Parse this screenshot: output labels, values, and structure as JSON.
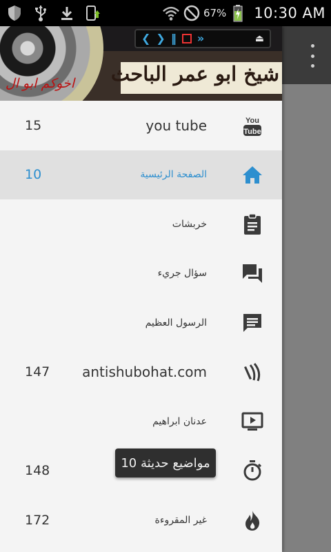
{
  "status_bar": {
    "battery_percent": "67%",
    "time": "10:30 AM",
    "icons": [
      "shield-icon",
      "usb-icon",
      "download-icon",
      "phone-signal-icon",
      "wifi-icon",
      "do-not-disturb-icon",
      "battery-charging-icon"
    ]
  },
  "drawer": {
    "banner": {
      "title": "شيخ ابو عمر الباحث",
      "subtitle": "اخوكم ابو ال"
    },
    "items": [
      {
        "label": "you tube",
        "count": "15",
        "icon": "youtube-icon",
        "active": false
      },
      {
        "label": "الصفحة الرئيسية",
        "count": "10",
        "icon": "home-icon",
        "active": true
      },
      {
        "label": "خربشات",
        "count": "",
        "icon": "clipboard-icon",
        "active": false
      },
      {
        "label": "سؤال جريء",
        "count": "",
        "icon": "forum-icon",
        "active": false
      },
      {
        "label": "الرسول العظيم",
        "count": "",
        "icon": "message-icon",
        "active": false
      },
      {
        "label": "antishubohat.com",
        "count": "147",
        "icon": "antenna-icon",
        "active": false
      },
      {
        "label": "عدنان ابراهيم",
        "count": "",
        "icon": "video-icon",
        "active": false
      },
      {
        "label": "",
        "count": "148",
        "icon": "timer-icon",
        "active": false
      },
      {
        "label": "غير المقروءة",
        "count": "172",
        "icon": "fire-icon",
        "active": false
      }
    ]
  },
  "toast": {
    "text": "10 مواضيع حديثة"
  },
  "colors": {
    "accent": "#2d8fcf",
    "drawer_bg": "#f4f4f4",
    "active_bg": "#e0e0e0",
    "scrim": "#808080",
    "toolbar": "#3b3b3b"
  }
}
